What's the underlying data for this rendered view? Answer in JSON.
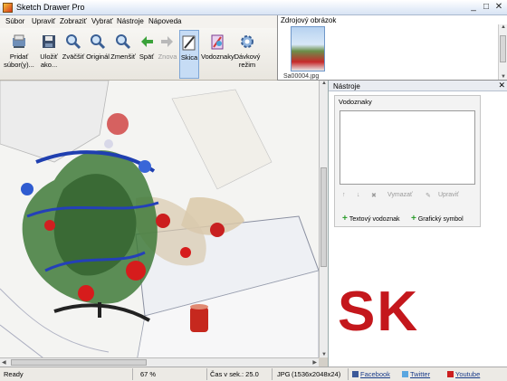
{
  "window": {
    "title": "Sketch Drawer Pro"
  },
  "menu": [
    {
      "label": "Súbor"
    },
    {
      "label": "Upraviť"
    },
    {
      "label": "Zobraziť"
    },
    {
      "label": "Vybrať"
    },
    {
      "label": "Nástroje"
    },
    {
      "label": "Nápoveda"
    }
  ],
  "toolbar": {
    "add_files_line1": "Pridať",
    "add_files_line2": "súbor(y)...",
    "save_as_line1": "Uložiť",
    "save_as_line2": "ako...",
    "zoom_in": "Zväčšiť",
    "original": "Originál",
    "zoom_out": "Zmenšiť",
    "undo": "Späť",
    "redo": "Znova",
    "sketch": "Skica",
    "watermarks": "Vodoznaky",
    "batch_line1": "Dávkový",
    "batch_line2": "režim"
  },
  "source_panel": {
    "title": "Zdrojový obrázok",
    "thumb_label": "Sa00004.jpg"
  },
  "tools_pane": {
    "title": "Nástroje",
    "group_label": "Vodoznaky",
    "delete_label": "Vymazať",
    "edit_label": "Upraviť",
    "add_text_label": "Textový vodoznak",
    "add_graphic_label": "Grafický symbol",
    "watermark_preview": "SK"
  },
  "status": {
    "ready": "Ready",
    "zoom": "67 %",
    "time": "Čas v sek.: 25.0",
    "format": "JPG",
    "dimensions": "(1536x2048x24)",
    "facebook": "Facebook",
    "twitter": "Twitter",
    "youtube": "Youtube"
  },
  "colors": {
    "accent": "#c4171c",
    "active_tool_bg": "#c6dcf5",
    "link": "#1a3c8a"
  }
}
